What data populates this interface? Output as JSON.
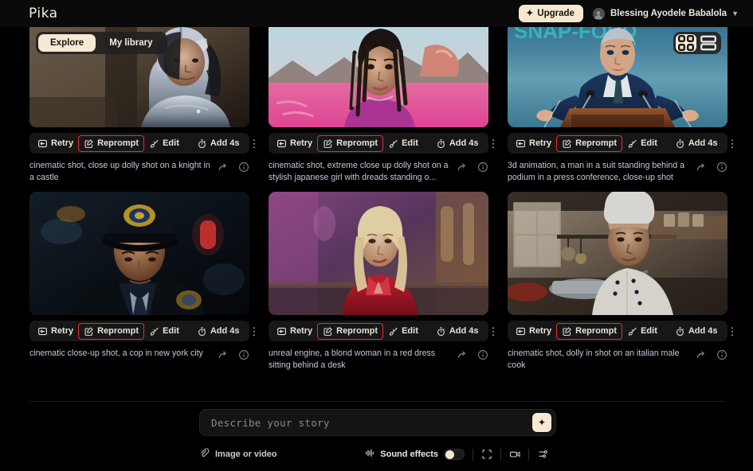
{
  "app": {
    "brand": "Pika"
  },
  "header": {
    "upgrade_label": "Upgrade",
    "upgrade_icon": "sparkle-icon",
    "account_name": "Blessing Ayodele Babalola",
    "account_chevron": "chevron-down-icon",
    "upgrade_bg": "#f6e7cf"
  },
  "tabs": {
    "explore": "Explore",
    "my_library": "My library",
    "active": "Explore"
  },
  "view_toggle": {
    "grid_label": "grid-view",
    "list_label": "list-view",
    "active": "grid"
  },
  "toolbar": {
    "retry": "Retry",
    "reprompt": "Reprompt",
    "edit": "Edit",
    "add": "Add 4s",
    "more": "⋮",
    "highlight_color": "#ef2b2b"
  },
  "cards": [
    {
      "id": "knight",
      "caption": "cinematic shot, close up dolly shot on a knight in a castle",
      "reprompt_highlighted": true
    },
    {
      "id": "japanese-girl",
      "caption": "cinematic shot, extreme close up dolly shot on a stylish japanese girl with dreads standing o...",
      "reprompt_highlighted": true
    },
    {
      "id": "press-conference",
      "caption": "3d animation, a man in a suit standing behind a podium in a press conference, close-up shot",
      "reprompt_highlighted": true
    },
    {
      "id": "cop",
      "caption": "cinematic close-up shot, a cop in new york city",
      "reprompt_highlighted": true
    },
    {
      "id": "blond-woman",
      "caption": "unreal engine, a blond woman in a red dress sitting behind a desk",
      "reprompt_highlighted": true
    },
    {
      "id": "italian-cook",
      "caption": "cinematic shot, dolly in shot on an italian male cook",
      "reprompt_highlighted": true
    }
  ],
  "prompt": {
    "placeholder": "Describe your story",
    "value": "",
    "send_icon": "sparkle-icon",
    "attach_label": "Image or video",
    "attach_icon": "paperclip-icon",
    "sound_effects_label": "Sound effects",
    "sound_effects_on": false,
    "aspect_icon": "crop-frame-icon",
    "camera_icon": "video-camera-icon",
    "settings_icon": "sliders-icon"
  }
}
